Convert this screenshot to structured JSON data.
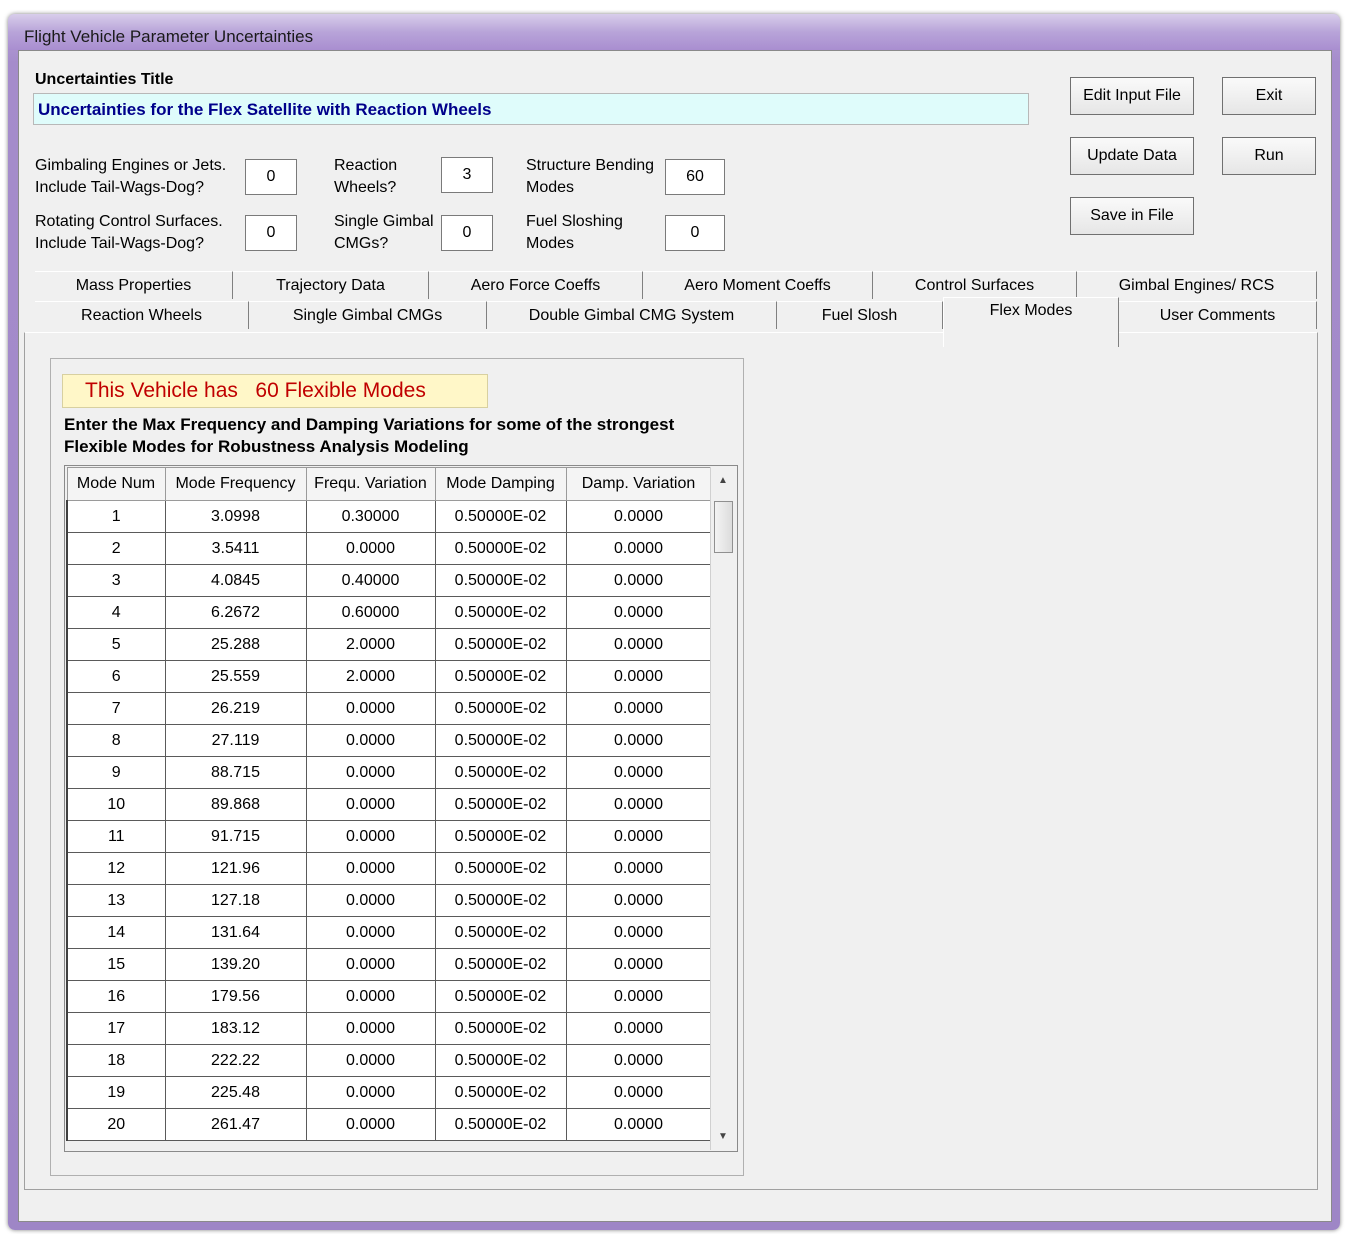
{
  "window": {
    "title": "Flight Vehicle Parameter Uncertainties"
  },
  "header": {
    "uncertainties_title_label": "Uncertainties Title",
    "uncertainties_title_value": "Uncertainties for the Flex Satellite with Reaction Wheels"
  },
  "params": {
    "gimbaling_label_1": "Gimbaling Engines or Jets.",
    "gimbaling_label_2": "Include Tail-Wags-Dog?",
    "gimbaling_value": "0",
    "rotating_label_1": "Rotating Control Surfaces.",
    "rotating_label_2": "Include Tail-Wags-Dog?",
    "rotating_value": "0",
    "reaction_label_1": "Reaction",
    "reaction_label_2": "Wheels?",
    "reaction_value": "3",
    "single_gimbal_label_1": "Single Gimbal",
    "single_gimbal_label_2": "CMGs?",
    "single_gimbal_value": "0",
    "bending_label_1": "Structure Bending",
    "bending_label_2": "Modes",
    "bending_value": "60",
    "sloshing_label_1": "Fuel Sloshing",
    "sloshing_label_2": "Modes",
    "sloshing_value": "0"
  },
  "buttons": {
    "edit_input_file": "Edit Input File",
    "exit": "Exit",
    "update_data": "Update Data",
    "run": "Run",
    "save_in_file": "Save in File"
  },
  "tabs_row1": [
    "Mass Properties",
    "Trajectory Data",
    "Aero Force Coeffs",
    "Aero Moment Coeffs",
    "Control Surfaces",
    "Gimbal Engines/ RCS"
  ],
  "tabs_row2": [
    "Reaction Wheels",
    "Single Gimbal CMGs",
    "Double Gimbal CMG System",
    "Fuel Slosh",
    "Flex Modes",
    "User Comments"
  ],
  "flex": {
    "banner": "This Vehicle has   60 Flexible Modes",
    "instructions_1": "Enter the Max Frequency and Damping Variations for some of the strongest",
    "instructions_2": "Flexible Modes for Robustness Analysis Modeling",
    "columns": [
      "Mode Num",
      "Mode Frequency",
      "Frequ. Variation",
      "Mode Damping",
      "Damp. Variation"
    ],
    "rows": [
      [
        "1",
        "3.0998",
        "0.30000",
        "0.50000E-02",
        "0.0000"
      ],
      [
        "2",
        "3.5411",
        "0.0000",
        "0.50000E-02",
        "0.0000"
      ],
      [
        "3",
        "4.0845",
        "0.40000",
        "0.50000E-02",
        "0.0000"
      ],
      [
        "4",
        "6.2672",
        "0.60000",
        "0.50000E-02",
        "0.0000"
      ],
      [
        "5",
        "25.288",
        "2.0000",
        "0.50000E-02",
        "0.0000"
      ],
      [
        "6",
        "25.559",
        "2.0000",
        "0.50000E-02",
        "0.0000"
      ],
      [
        "7",
        "26.219",
        "0.0000",
        "0.50000E-02",
        "0.0000"
      ],
      [
        "8",
        "27.119",
        "0.0000",
        "0.50000E-02",
        "0.0000"
      ],
      [
        "9",
        "88.715",
        "0.0000",
        "0.50000E-02",
        "0.0000"
      ],
      [
        "10",
        "89.868",
        "0.0000",
        "0.50000E-02",
        "0.0000"
      ],
      [
        "11",
        "91.715",
        "0.0000",
        "0.50000E-02",
        "0.0000"
      ],
      [
        "12",
        "121.96",
        "0.0000",
        "0.50000E-02",
        "0.0000"
      ],
      [
        "13",
        "127.18",
        "0.0000",
        "0.50000E-02",
        "0.0000"
      ],
      [
        "14",
        "131.64",
        "0.0000",
        "0.50000E-02",
        "0.0000"
      ],
      [
        "15",
        "139.20",
        "0.0000",
        "0.50000E-02",
        "0.0000"
      ],
      [
        "16",
        "179.56",
        "0.0000",
        "0.50000E-02",
        "0.0000"
      ],
      [
        "17",
        "183.12",
        "0.0000",
        "0.50000E-02",
        "0.0000"
      ],
      [
        "18",
        "222.22",
        "0.0000",
        "0.50000E-02",
        "0.0000"
      ],
      [
        "19",
        "225.48",
        "0.0000",
        "0.50000E-02",
        "0.0000"
      ],
      [
        "20",
        "261.47",
        "0.0000",
        "0.50000E-02",
        "0.0000"
      ]
    ]
  }
}
